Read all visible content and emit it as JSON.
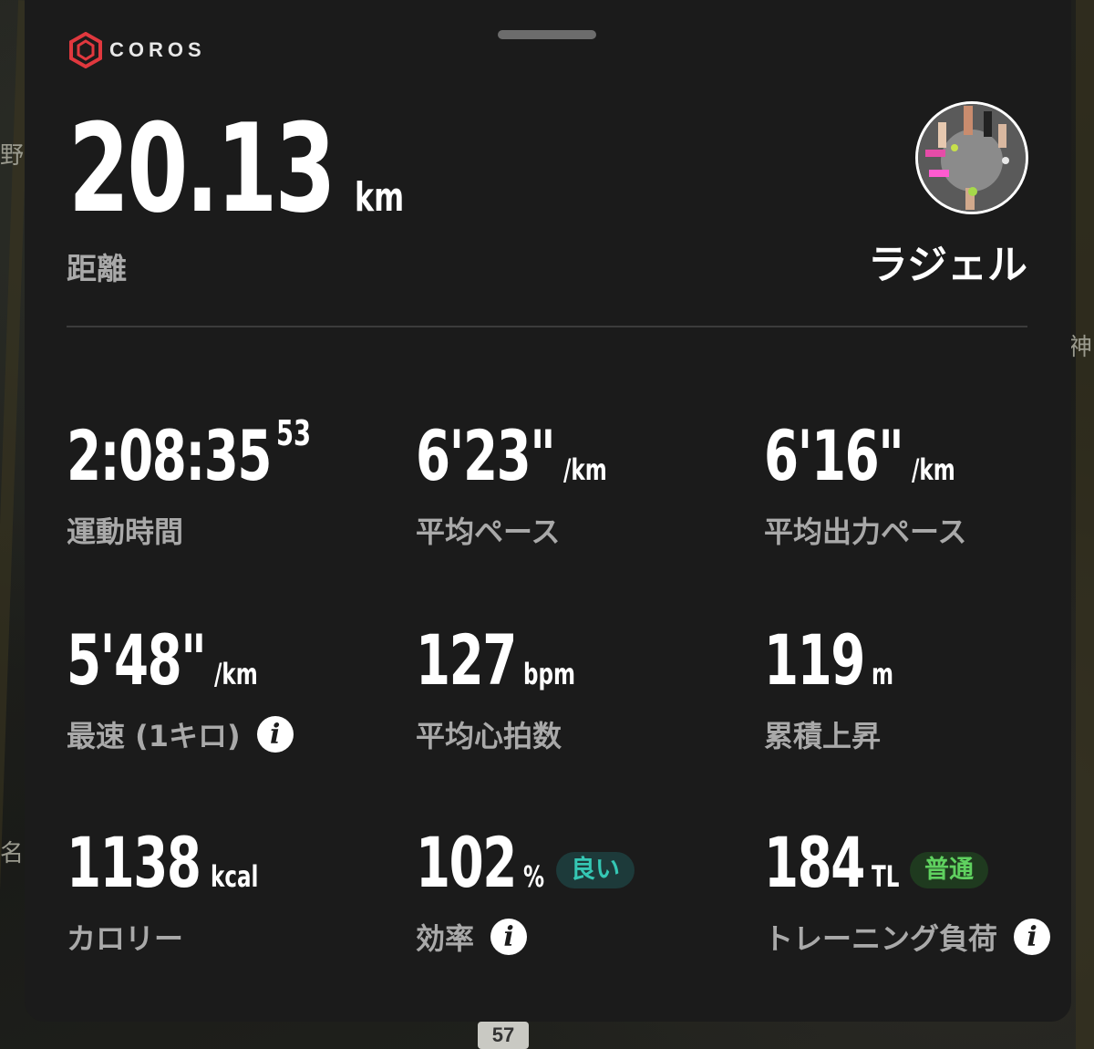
{
  "app": {
    "brand": "COROS",
    "brand_color": "#e0383e"
  },
  "map": {
    "labels": [
      "野",
      "神",
      "名"
    ],
    "route_shield": "57"
  },
  "summary": {
    "distance_value": "20.13",
    "distance_unit": "km",
    "distance_label": "距離",
    "user_name": "ラジェル"
  },
  "stats": [
    {
      "value": "2:08:35",
      "sup": "53",
      "unit": "",
      "label": "運動時間",
      "info": false
    },
    {
      "value": "6'23\"",
      "unit": "/km",
      "label": "平均ペース",
      "info": false
    },
    {
      "value": "6'16\"",
      "unit": "/km",
      "label": "平均出力ペース",
      "info": false
    },
    {
      "value": "5'48\"",
      "unit": "/km",
      "label": "最速 (1キロ)",
      "info": true
    },
    {
      "value": "127",
      "unit": "bpm",
      "label": "平均心拍数",
      "info": false
    },
    {
      "value": "119",
      "unit": "m",
      "label": "累積上昇",
      "info": false
    },
    {
      "value": "1138",
      "unit": "kcal",
      "label": "カロリー",
      "info": false
    },
    {
      "value": "102",
      "unit": "%",
      "badge": "良い",
      "label": "効率",
      "info": true
    },
    {
      "value": "184",
      "unit": "TL",
      "badge": "普通",
      "label": "トレーニング負荷",
      "info": true
    }
  ],
  "icons": {
    "info": "i"
  }
}
